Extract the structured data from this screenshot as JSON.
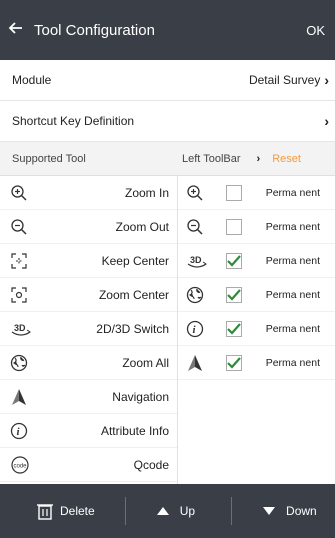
{
  "header": {
    "title": "Tool Configuration",
    "ok_label": "OK"
  },
  "rows": {
    "module": {
      "label": "Module",
      "value": "Detail Survey"
    },
    "shortcut": {
      "label": "Shortcut Key Definition"
    }
  },
  "subheader": {
    "left": "Supported Tool",
    "right": "Left ToolBar",
    "reset": "Reset"
  },
  "supported_tools": [
    {
      "name": "Zoom In",
      "icon": "zoom-in-icon"
    },
    {
      "name": "Zoom Out",
      "icon": "zoom-out-icon"
    },
    {
      "name": "Keep Center",
      "icon": "keep-center-icon"
    },
    {
      "name": "Zoom Center",
      "icon": "zoom-center-icon"
    },
    {
      "name": "2D/3D Switch",
      "icon": "3d-icon"
    },
    {
      "name": "Zoom All",
      "icon": "globe-icon"
    },
    {
      "name": "Navigation",
      "icon": "navigation-icon"
    },
    {
      "name": "Attribute Info",
      "icon": "info-icon"
    },
    {
      "name": "Qcode",
      "icon": "qcode-icon"
    }
  ],
  "toolbar_items": [
    {
      "icon": "zoom-in-icon",
      "checked": false,
      "status": "Perma nent"
    },
    {
      "icon": "zoom-out-icon",
      "checked": false,
      "status": "Perma nent"
    },
    {
      "icon": "3d-icon",
      "checked": true,
      "status": "Perma nent"
    },
    {
      "icon": "globe-icon",
      "checked": true,
      "status": "Perma nent"
    },
    {
      "icon": "info-icon",
      "checked": true,
      "status": "Perma nent"
    },
    {
      "icon": "navigation-icon",
      "checked": true,
      "status": "Perma nent"
    }
  ],
  "bottom": {
    "delete_label": "Delete",
    "up_label": "Up",
    "down_label": "Down"
  },
  "colors": {
    "bar": "#3a3f47",
    "accent": "#f39c3c",
    "check": "#2e8b3e"
  }
}
